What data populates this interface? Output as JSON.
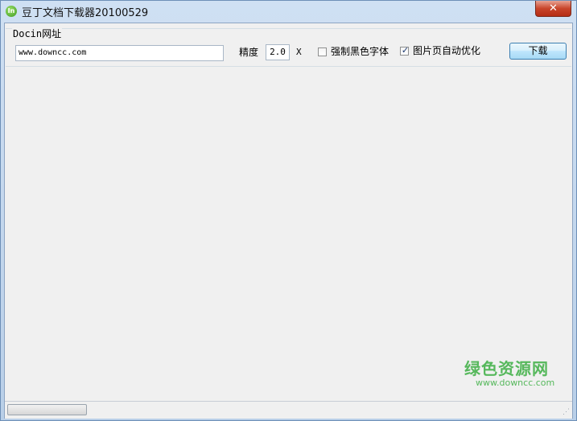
{
  "window": {
    "title": "豆丁文档下载器20100529",
    "icon_text": "In",
    "close_glyph": "✕"
  },
  "form": {
    "group_label": "Docin网址",
    "url_value": "www.downcc.com",
    "precision_label": "精度",
    "precision_value": "2.0",
    "precision_unit": "X",
    "force_black_label": "强制黑色字体",
    "force_black_checked": false,
    "auto_optimize_label": "图片页自动优化",
    "auto_optimize_checked": true,
    "check_glyph": "✓",
    "download_label": "下载"
  },
  "status": {
    "progress_fraction": 0.0
  },
  "watermark": {
    "cn": "绿色资源网",
    "en": "www.downcc.com",
    "color": "#56b85c"
  }
}
